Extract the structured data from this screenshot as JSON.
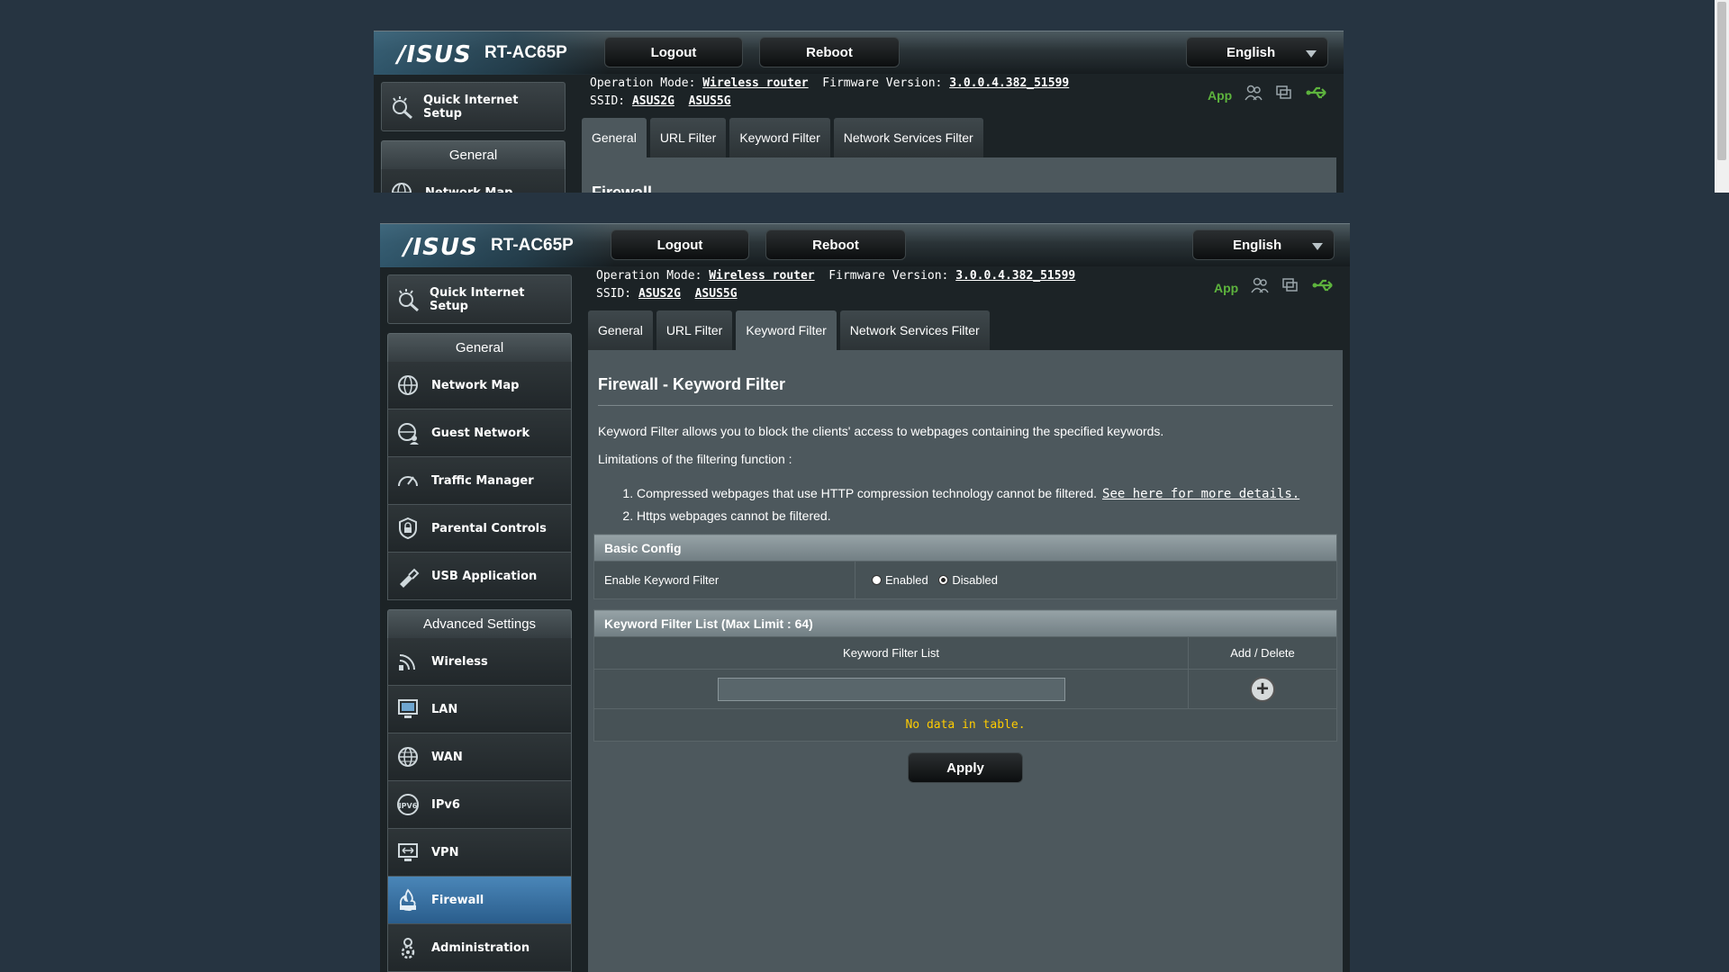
{
  "header": {
    "logo": "/ISUS",
    "model": "RT-AC65P",
    "logout_label": "Logout",
    "reboot_label": "Reboot",
    "language": "English"
  },
  "info": {
    "operation_mode_label": "Operation Mode:",
    "operation_mode_value": "Wireless router",
    "firmware_label": "Firmware Version:",
    "firmware_value": "3.0.0.4.382_51599",
    "ssid_label": "SSID:",
    "ssid_2g": "ASUS2G",
    "ssid_5g": "ASUS5G",
    "app_label": "App"
  },
  "sidebar": {
    "qis_label_1": "Quick Internet",
    "qis_label_2": "Setup",
    "general_header": "General",
    "general_items": [
      {
        "label": "Network Map"
      },
      {
        "label": "Guest Network"
      },
      {
        "label": "Traffic Manager"
      },
      {
        "label": "Parental Controls"
      },
      {
        "label": "USB Application"
      }
    ],
    "advanced_header": "Advanced Settings",
    "advanced_items": [
      {
        "label": "Wireless"
      },
      {
        "label": "LAN"
      },
      {
        "label": "WAN"
      },
      {
        "label": "IPv6"
      },
      {
        "label": "VPN"
      },
      {
        "label": "Firewall"
      },
      {
        "label": "Administration"
      }
    ]
  },
  "tabs": [
    {
      "label": "General"
    },
    {
      "label": "URL Filter"
    },
    {
      "label": "Keyword Filter"
    },
    {
      "label": "Network Services Filter"
    }
  ],
  "top_content_title": "Firewall",
  "content": {
    "title": "Firewall - Keyword Filter",
    "description": "Keyword Filter allows you to block the clients' access to webpages containing the specified keywords.",
    "limitations": "Limitations of the filtering function :",
    "limit_1": "Compressed webpages that use HTTP compression technology cannot be filtered.",
    "limit_1_link": "See here for more details.",
    "limit_2": "Https webpages cannot be filtered.",
    "basic_config": "Basic Config",
    "enable_label": "Enable Keyword Filter",
    "enabled": "Enabled",
    "disabled": "Disabled",
    "list_header": "Keyword Filter List (Max Limit : 64)",
    "col_list": "Keyword Filter List",
    "col_add_delete": "Add / Delete",
    "no_data": "No data in table.",
    "apply_label": "Apply"
  },
  "colors": {
    "background": "#263441",
    "active_menu": "#2a5d8c",
    "usb_green": "#5db33d",
    "no_data": "#ffcc00"
  }
}
